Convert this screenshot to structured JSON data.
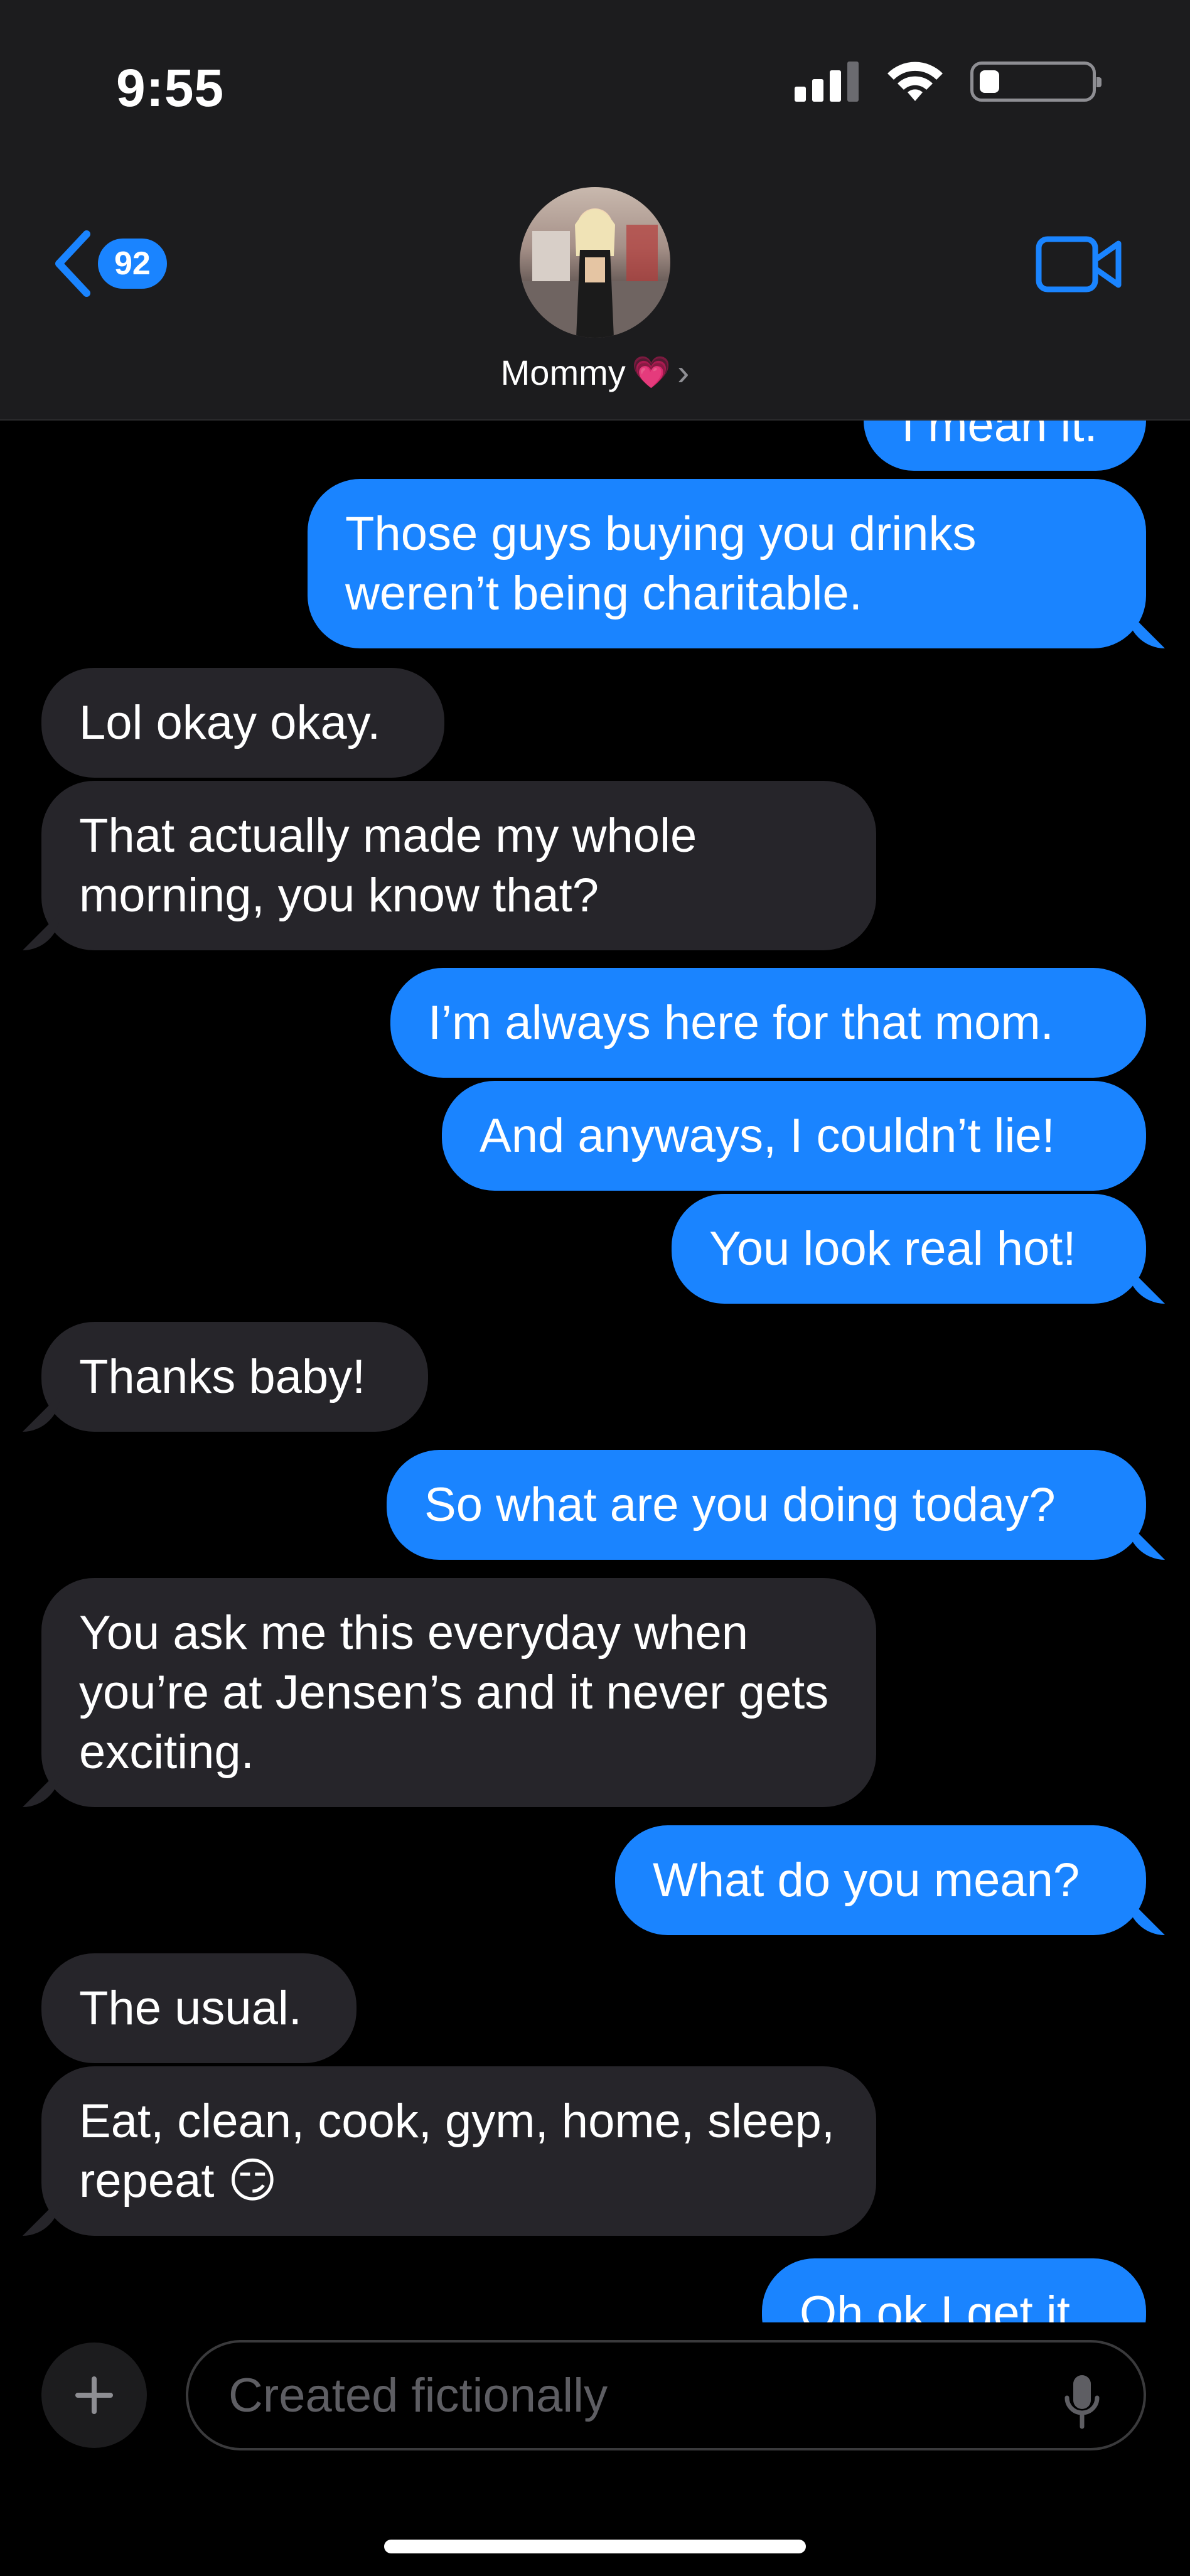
{
  "status_bar": {
    "time": "9:55",
    "battery_level": 0.18
  },
  "header": {
    "back_count": "92",
    "contact_name": "Mommy",
    "contact_emoji": "💗",
    "chevron": "›"
  },
  "messages": [
    {
      "dir": "out",
      "text": "I mean it."
    },
    {
      "dir": "out",
      "text": "Those guys buying you drinks weren’t being charitable."
    },
    {
      "dir": "in",
      "text": "Lol okay okay."
    },
    {
      "dir": "in",
      "text": "That actually made my whole morning, you know that?"
    },
    {
      "dir": "out",
      "text": "I’m always here for that mom."
    },
    {
      "dir": "out",
      "text": "And anyways, I couldn’t lie!"
    },
    {
      "dir": "out",
      "text": "You look real hot!"
    },
    {
      "dir": "in",
      "text": "Thanks baby!"
    },
    {
      "dir": "out",
      "text": "So what are you doing today?"
    },
    {
      "dir": "in",
      "text": "You ask me this everyday when you’re at Jensen’s and it never gets exciting."
    },
    {
      "dir": "out",
      "text": "What do you mean?"
    },
    {
      "dir": "in",
      "text": "The usual."
    },
    {
      "dir": "in",
      "text": "Eat, clean, cook, gym, home, sleep, repeat 😏"
    },
    {
      "dir": "out",
      "text": "Oh ok I get it."
    }
  ],
  "composer": {
    "placeholder": "Created fictionally"
  },
  "colors": {
    "outgoing": "#1a84ff",
    "incoming": "#26252a",
    "accent": "#1a84ff"
  }
}
